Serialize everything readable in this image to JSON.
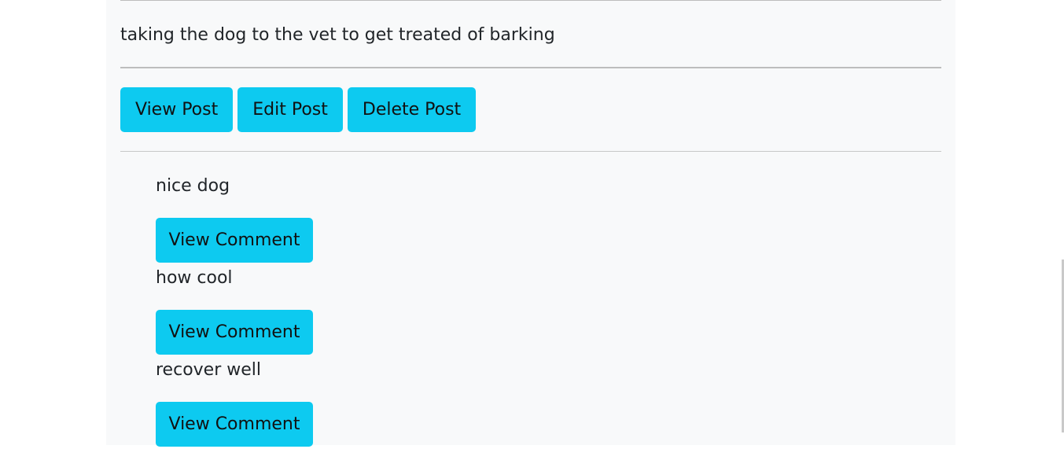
{
  "post": {
    "body": "taking the dog to the vet to get treated of barking",
    "actions": {
      "view_label": "View Post",
      "edit_label": "Edit Post",
      "delete_label": "Delete Post"
    }
  },
  "comments": [
    {
      "text": "nice dog",
      "button_label": "View Comment"
    },
    {
      "text": "how cool",
      "button_label": "View Comment"
    },
    {
      "text": "recover well",
      "button_label": "View Comment"
    }
  ],
  "colors": {
    "accent": "#0dcaf0",
    "card_background": "#f8f9fa",
    "text": "#212529"
  }
}
